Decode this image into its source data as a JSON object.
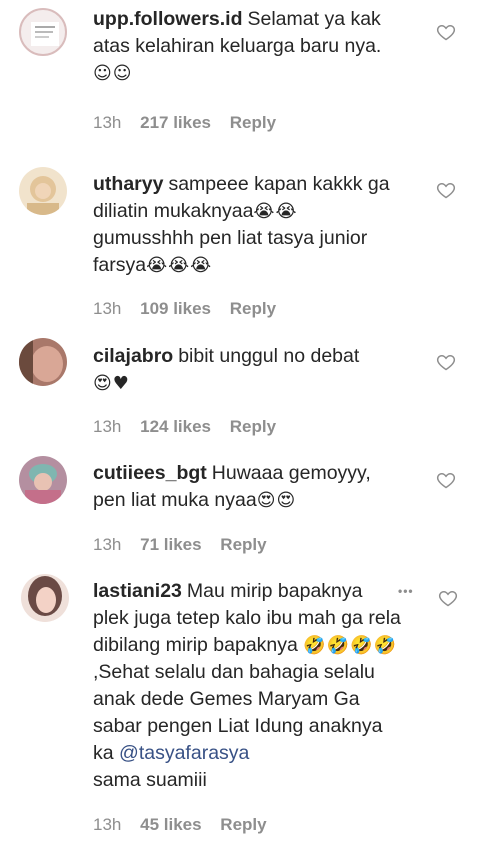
{
  "comments": [
    {
      "username": "upp.followers.id",
      "text": "Selamat ya kak atas kelahiran keluarga baru nya.",
      "emoji": "☺☺",
      "time": "13h",
      "likes": "217 likes",
      "reply": "Reply",
      "avatar_color": "#d9cfcf"
    },
    {
      "username": "utharyy",
      "text_lines": [
        "sampeee kapan kakkk ga diliatin mukaknyaa",
        "gumusshhh pen liat tasya junior farsya"
      ],
      "emoji_a": "😭😭",
      "emoji_b": "😭😭😭",
      "time": "13h",
      "likes": "109 likes",
      "reply": "Reply",
      "avatar_color": "#e8cfa6"
    },
    {
      "username": "cilajabro",
      "text": "bibit unggul no debat",
      "emoji": "😍♥",
      "time": "13h",
      "likes": "124 likes",
      "reply": "Reply",
      "avatar_color": "#b98a78"
    },
    {
      "username": "cutiiees_bgt",
      "text": "Huwaaa gemoyyy, pen liat muka nyaa",
      "emoji": "😍😍",
      "time": "13h",
      "likes": "71 likes",
      "reply": "Reply",
      "avatar_color": "#c48a9a"
    },
    {
      "username": "lastiani23",
      "text_a": "Mau mirip bapaknya plek juga tetep kalo ibu mah ga rela dibilang mirip bapaknya",
      "emoji_a": "🤣🤣🤣🤣",
      "text_b": ",Sehat selalu dan bahagia selalu anak dede Gemes Maryam Ga sabar pengen Liat Idung anaknya ka",
      "mention": "@tasyafarasya",
      "text_c": "sama suamiii",
      "time": "13h",
      "likes": "45 likes",
      "reply": "Reply",
      "more": "•••",
      "avatar_color": "#d6b1a3"
    }
  ],
  "colors": {
    "text": "#262626",
    "meta": "#8e8e8e",
    "mention": "#385185"
  },
  "icons": {
    "like": "heart-outline-icon",
    "more": "more-options-icon"
  }
}
